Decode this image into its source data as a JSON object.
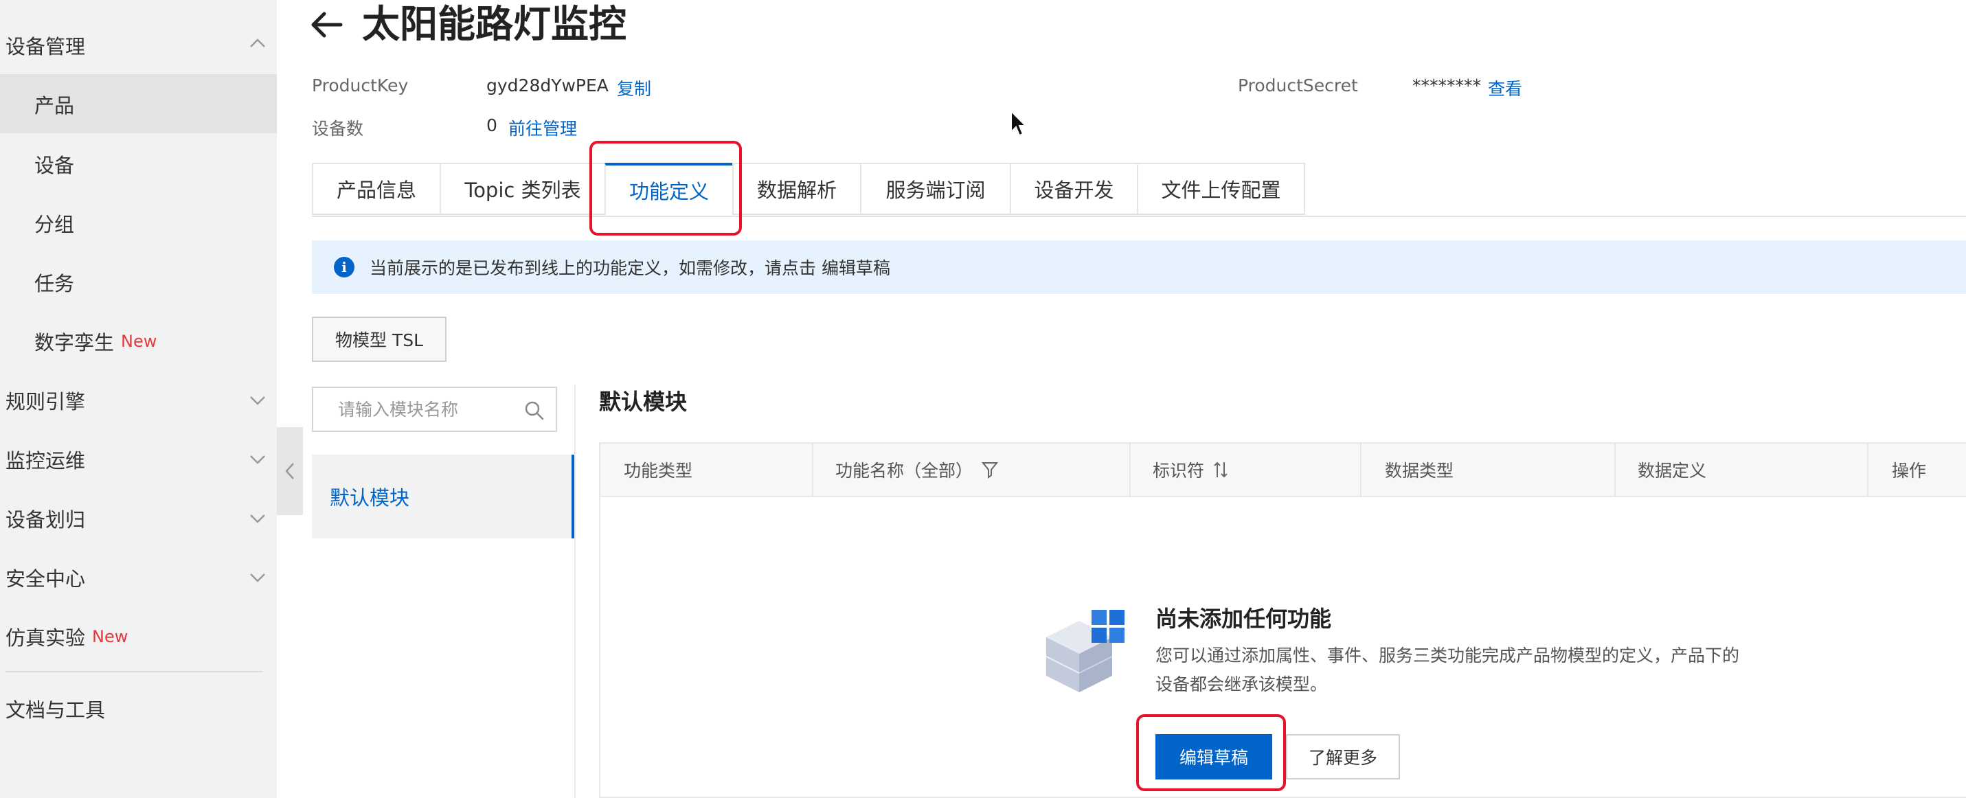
{
  "sidebar": {
    "device_management": "设备管理",
    "items": [
      {
        "label": "产品",
        "active": true
      },
      {
        "label": "设备"
      },
      {
        "label": "分组"
      },
      {
        "label": "任务"
      },
      {
        "label": "数字孪生",
        "badge": "New"
      }
    ],
    "sections": [
      {
        "label": "规则引擎"
      },
      {
        "label": "监控运维"
      },
      {
        "label": "设备划归"
      },
      {
        "label": "安全中心"
      },
      {
        "label": "仿真实验",
        "badge": "New"
      },
      {
        "label": "文档与工具"
      }
    ]
  },
  "header": {
    "title": "太阳能路灯监控",
    "product_key_label": "ProductKey",
    "product_key_value": "gyd28dYwPEA",
    "copy_link": "复制",
    "product_secret_label": "ProductSecret",
    "product_secret_value": "********",
    "view_link": "查看",
    "device_count_label": "设备数",
    "device_count_value": "0",
    "manage_link": "前往管理"
  },
  "tabs": [
    {
      "label": "产品信息"
    },
    {
      "label": "Topic 类列表"
    },
    {
      "label": "功能定义",
      "active": true
    },
    {
      "label": "数据解析"
    },
    {
      "label": "服务端订阅"
    },
    {
      "label": "设备开发"
    },
    {
      "label": "文件上传配置"
    }
  ],
  "banner": {
    "text": "当前展示的是已发布到线上的功能定义，如需修改，请点击",
    "link": "编辑草稿"
  },
  "tsl_button": "物模型 TSL",
  "module_search": {
    "placeholder": "请输入模块名称"
  },
  "module_list": [
    {
      "label": "默认模块",
      "active": true
    }
  ],
  "section_title": "默认模块",
  "table": {
    "columns": [
      "功能类型",
      "功能名称（全部）",
      "标识符",
      "数据类型",
      "数据定义",
      "操作"
    ]
  },
  "empty_state": {
    "title": "尚未添加任何功能",
    "description": "您可以通过添加属性、事件、服务三类功能完成产品物模型的定义，产品下的设备都会继承该模型。",
    "primary_button": "编辑草稿",
    "secondary_button": "了解更多"
  },
  "colors": {
    "accent": "#0064c8",
    "new_badge": "#e4393c",
    "annotation": "#e5142b",
    "banner_bg": "#e6f2fd"
  }
}
